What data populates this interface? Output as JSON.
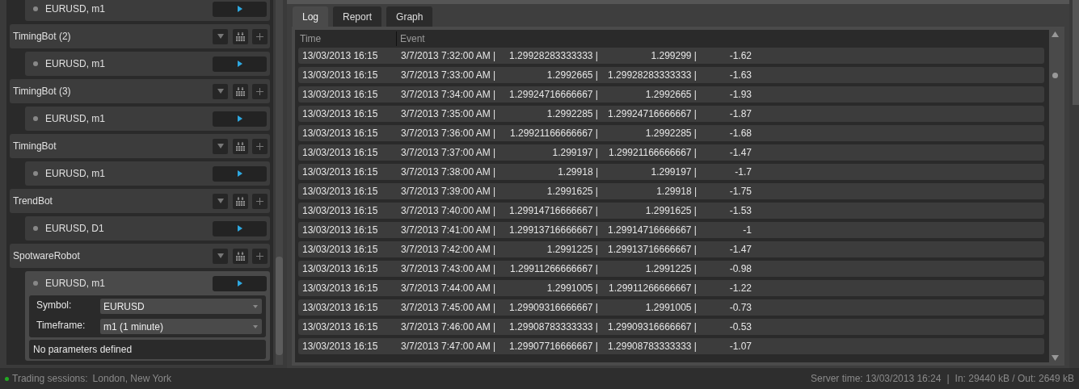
{
  "robots": [
    {
      "kind": "instance",
      "label": "EURUSD, m1",
      "expanded": false
    },
    {
      "kind": "bot",
      "label": "TimingBot (2)"
    },
    {
      "kind": "instance",
      "label": "EURUSD, m1",
      "expanded": false
    },
    {
      "kind": "bot",
      "label": "TimingBot (3)"
    },
    {
      "kind": "instance",
      "label": "EURUSD, m1",
      "expanded": false
    },
    {
      "kind": "bot",
      "label": "TimingBot"
    },
    {
      "kind": "instance",
      "label": "EURUSD, m1",
      "expanded": false
    },
    {
      "kind": "bot",
      "label": "TrendBot"
    },
    {
      "kind": "instance",
      "label": "EURUSD, D1",
      "expanded": false
    },
    {
      "kind": "bot",
      "label": "SpotwareRobot"
    },
    {
      "kind": "instance",
      "label": "EURUSD, m1",
      "expanded": true,
      "settings": [
        {
          "label": "Symbol:",
          "value": "EURUSD"
        },
        {
          "label": "Timeframe:",
          "value": "m1 (1 minute)"
        }
      ],
      "parameters_note": "No parameters defined"
    }
  ],
  "tabs": [
    {
      "label": "Log",
      "selected": true
    },
    {
      "label": "Report",
      "selected": false
    },
    {
      "label": "Graph",
      "selected": false
    }
  ],
  "log": {
    "columns": [
      "Time",
      "Event"
    ],
    "rows": [
      {
        "time": "13/03/2013 16:15",
        "event": [
          "3/7/2013 7:32:00 AM |",
          "1.29928283333333 |",
          "1.299299 |",
          "-1.62"
        ]
      },
      {
        "time": "13/03/2013 16:15",
        "event": [
          "3/7/2013 7:33:00 AM |",
          "1.2992665 |",
          "1.29928283333333 |",
          "-1.63"
        ]
      },
      {
        "time": "13/03/2013 16:15",
        "event": [
          "3/7/2013 7:34:00 AM |",
          "1.29924716666667 |",
          "1.2992665 |",
          "-1.93"
        ]
      },
      {
        "time": "13/03/2013 16:15",
        "event": [
          "3/7/2013 7:35:00 AM |",
          "1.2992285 |",
          "1.29924716666667 |",
          "-1.87"
        ]
      },
      {
        "time": "13/03/2013 16:15",
        "event": [
          "3/7/2013 7:36:00 AM |",
          "1.29921166666667 |",
          "1.2992285 |",
          "-1.68"
        ]
      },
      {
        "time": "13/03/2013 16:15",
        "event": [
          "3/7/2013 7:37:00 AM |",
          "1.299197 |",
          "1.29921166666667 |",
          "-1.47"
        ]
      },
      {
        "time": "13/03/2013 16:15",
        "event": [
          "3/7/2013 7:38:00 AM |",
          "1.29918 |",
          "1.299197 |",
          "-1.7"
        ]
      },
      {
        "time": "13/03/2013 16:15",
        "event": [
          "3/7/2013 7:39:00 AM |",
          "1.2991625 |",
          "1.29918 |",
          "-1.75"
        ]
      },
      {
        "time": "13/03/2013 16:15",
        "event": [
          "3/7/2013 7:40:00 AM |",
          "1.29914716666667 |",
          "1.2991625 |",
          "-1.53"
        ]
      },
      {
        "time": "13/03/2013 16:15",
        "event": [
          "3/7/2013 7:41:00 AM |",
          "1.29913716666667 |",
          "1.29914716666667 |",
          "-1"
        ]
      },
      {
        "time": "13/03/2013 16:15",
        "event": [
          "3/7/2013 7:42:00 AM |",
          "1.2991225 |",
          "1.29913716666667 |",
          "-1.47"
        ]
      },
      {
        "time": "13/03/2013 16:15",
        "event": [
          "3/7/2013 7:43:00 AM |",
          "1.29911266666667 |",
          "1.2991225 |",
          "-0.98"
        ]
      },
      {
        "time": "13/03/2013 16:15",
        "event": [
          "3/7/2013 7:44:00 AM |",
          "1.2991005 |",
          "1.29911266666667 |",
          "-1.22"
        ]
      },
      {
        "time": "13/03/2013 16:15",
        "event": [
          "3/7/2013 7:45:00 AM |",
          "1.29909316666667 |",
          "1.2991005 |",
          "-0.73"
        ]
      },
      {
        "time": "13/03/2013 16:15",
        "event": [
          "3/7/2013 7:46:00 AM |",
          "1.29908783333333 |",
          "1.29909316666667 |",
          "-0.53"
        ]
      },
      {
        "time": "13/03/2013 16:15",
        "event": [
          "3/7/2013 7:47:00 AM |",
          "1.29907716666667 |",
          "1.29908783333333 |",
          "-1.07"
        ]
      }
    ]
  },
  "status_bar": {
    "sessions_label": "Trading sessions:",
    "sessions": "London, New York",
    "server_time": "Server time: 13/03/2013 16:24",
    "separator": "|",
    "traffic": "In: 29440 kB / Out: 2649 kB"
  }
}
